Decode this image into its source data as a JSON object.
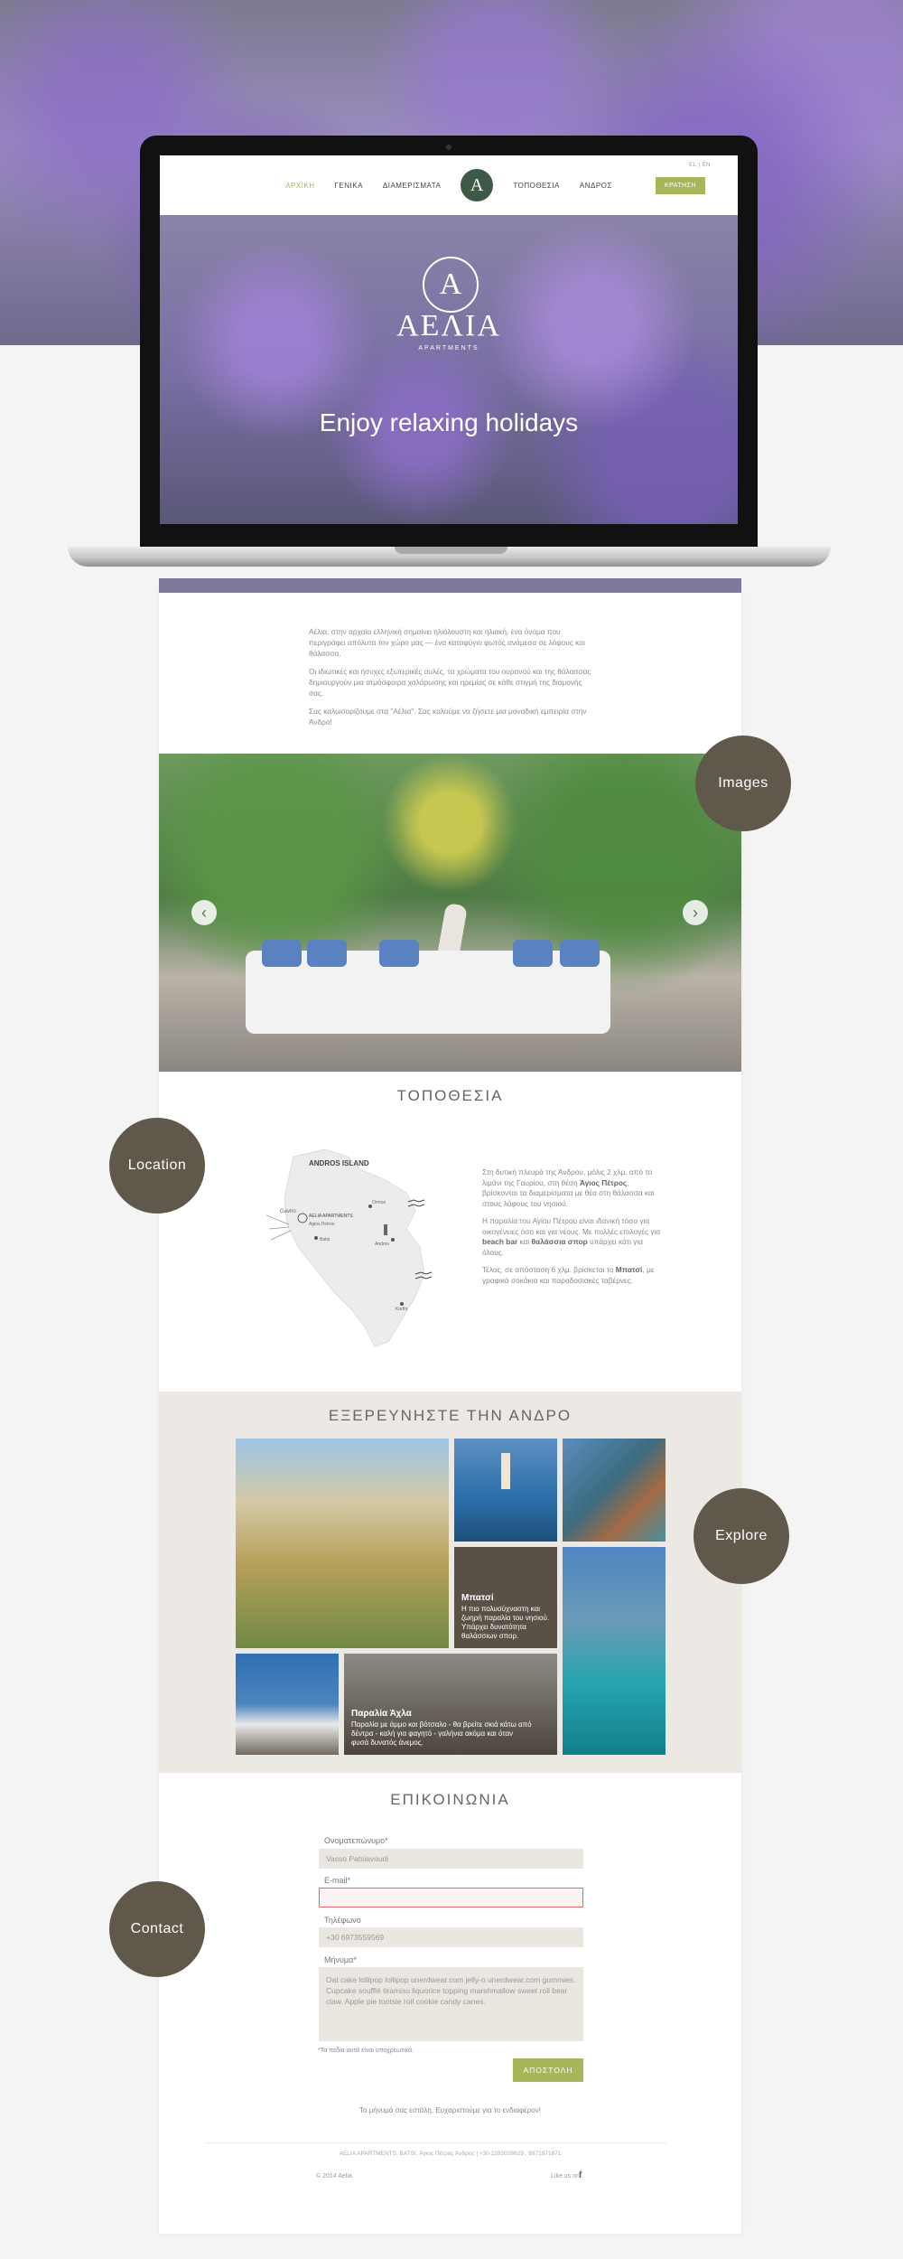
{
  "inner_site": {
    "nav_items": [
      "ΑΡΧΙΚΗ",
      "ΓΕΝΙΚΑ",
      "ΔΙΑΜΕΡΙΣΜΑΤΑ",
      "ΤΟΠΟΘΕΣΙΑ",
      "ΑΝΔΡΟΣ"
    ],
    "logo_letter": "A",
    "book_button": "ΚΡΑΤΗΣΗ",
    "lang": "EL | EN",
    "brand": "ΑΕΛΙΑ",
    "brand_sub": "APARTMENTS",
    "tagline": "Enjoy relaxing holidays"
  },
  "intro": {
    "p1": "Αέλια, στην αρχαία ελληνική σημαίνει ηλιόλουστη και ηλιακή, ένα όνομα που περιγράφει απόλυτα τον χώρο μας — ένα καταφύγιο φωτός ανάμεσα σε λόφους και θάλασσα.",
    "p2": "Οι ιδιωτικές και ήσυχες εξωτερικές αυλές, τα χρώματα του ουρανού και της θάλασσας δημιουργούν μια ατμόσφαιρα χαλάρωσης και ηρεμίας σε κάθε στιγμή της διαμονής σας.",
    "p3": "Σας καλωσορίζουμε στα \"Αέλια\". Σας καλούμε να ζήσετε μια μοναδική εμπειρία στην Άνδρο!"
  },
  "bubbles": {
    "images": "Images",
    "location": "Location",
    "explore": "Explore",
    "contact": "Contact"
  },
  "location": {
    "title": "ΤΟΠΟΘΕΣΙΑ",
    "map_title": "ANDROS ISLAND",
    "map_labels": {
      "gavrio": "Gavrio",
      "aelia": "AELIA APARTMENTS",
      "agios": "Agios Petros",
      "batsi": "Batsi",
      "andros": "Andros",
      "korthi": "Korthi",
      "ormos": "Ormos"
    },
    "p1_pre": "Στη δυτική πλευρά της Άνδρου, μόλις 2 χλμ. από το λιμάνι της Γαυρίου, στη θέση ",
    "p1_bold": "Άγιος Πέτρος",
    "p1_post": ", βρίσκονται τα διαμερίσματα με θέα στη θάλασσα και στους λόφους του νησιού.",
    "p2_pre": "Η παραλία του Αγίου Πέτρου είναι ιδανική τόσο για οικογένειες όσο και για νέους. Με πολλές επιλογές για ",
    "p2_bold1": "beach bar",
    "p2_mid": " και ",
    "p2_bold2": "θαλάσσια σπορ",
    "p2_post": " υπάρχει κάτι για όλους.",
    "p3_pre": "Τέλος, σε απόσταση 6 χλμ. βρίσκεται το ",
    "p3_bold": "Μπατσί",
    "p3_post": ", με γραφικά σοκάκια και παραδοσιακές ταβέρνες."
  },
  "explore": {
    "title": "ΕΞΕΡΕΥΝΗΣΤΕ ΤΗΝ ΑΝΔΡΟ",
    "tile1_title": "Μπατσί",
    "tile1_text": "Η πιο πολυσύχναστη και ζωηρή παραλία του νησιού. Υπάρχει δυνατότητα θαλάσσιων σπορ.",
    "tile2_title": "Παραλία Άχλα",
    "tile2_text": "Παραλία με άμμο και βότσαλο - θα βρείτε σκιά κάτω από δέντρα - καλή για φαγητό - γαλήνια ακόμα και όταν φυσά δυνατός άνεμος."
  },
  "contact": {
    "title": "ΕΠΙΚΟΙΝΩΝΙΑ",
    "name_label": "Ονοματεπώνυμο*",
    "name_value": "Vasso Patsiavoudi",
    "email_label": "E-mail*",
    "phone_label": "Τηλέφωνο",
    "phone_value": "+30 6973559569",
    "message_label": "Μήνυμα*",
    "message_value": "Oat cake lollipop lollipop unerdwear.com jelly-o unerdwear.com gummies. Cupcake soufflé tiramisu liquorice topping marshmallow sweet roll bear claw. Apple pie tootsie roll cookie candy canes.",
    "required_note": "*Τα πεδία αυτά είναι υποχρεωτικά.",
    "submit": "ΑΠΟΣΤΟΛΗ",
    "success": "Το μήνυμά σας εστάλη. Ευχαριστούμε για το ενδιαφέρον!"
  },
  "footer": {
    "address": "AELIA APARTMENTS, BATSI, Άγιος Πέτρος Άνδρος | +30 2282028629 , 6971971871",
    "copyright": "© 2014 Aelia",
    "like": "Like us on",
    "fb": "f"
  },
  "colors": {
    "accent": "#a6b65a",
    "bubble": "#5f584b",
    "explore_bg": "#ece9e4"
  }
}
